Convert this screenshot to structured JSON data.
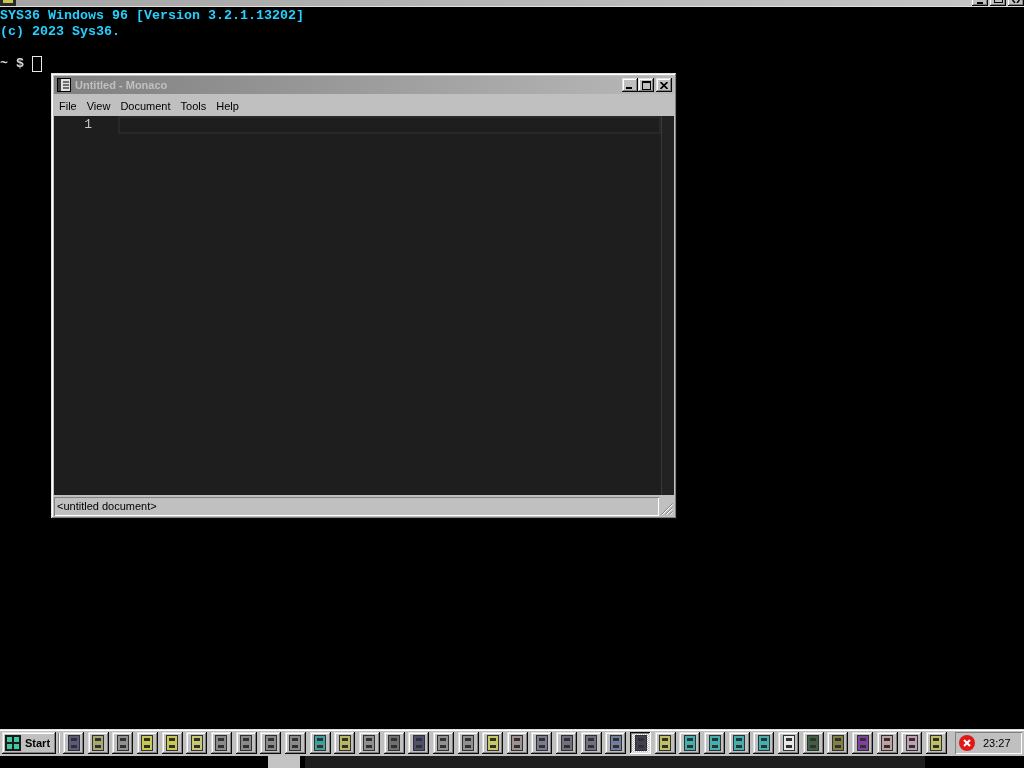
{
  "terminal": {
    "lines": [
      "SYS36 Windows 96 [Version 3.2.1.13202]",
      "(c) 2023 Sys36."
    ],
    "prompt": "~ $"
  },
  "window": {
    "title": "Untitled - Monaco",
    "active": false,
    "menu": [
      "File",
      "View",
      "Document",
      "Tools",
      "Help"
    ],
    "editor": {
      "line_numbers": [
        "1"
      ]
    },
    "status_bar": "<untitled document>"
  },
  "taskbar": {
    "start": "Start",
    "buttons": [
      {
        "selected": false,
        "color": "#5a5a7a"
      },
      {
        "selected": false,
        "color": "#a8a870"
      },
      {
        "selected": false,
        "color": "#909090"
      },
      {
        "selected": false,
        "color": "#c8c850"
      },
      {
        "selected": false,
        "color": "#c8c850"
      },
      {
        "selected": false,
        "color": "#c8c870"
      },
      {
        "selected": false,
        "color": "#8a8a8a"
      },
      {
        "selected": false,
        "color": "#8a8a8a"
      },
      {
        "selected": false,
        "color": "#8a8a8a"
      },
      {
        "selected": false,
        "color": "#8a8a8a"
      },
      {
        "selected": false,
        "color": "#40a0a0"
      },
      {
        "selected": false,
        "color": "#b8b860"
      },
      {
        "selected": false,
        "color": "#909090"
      },
      {
        "selected": false,
        "color": "#707070"
      },
      {
        "selected": false,
        "color": "#505070"
      },
      {
        "selected": false,
        "color": "#909090"
      },
      {
        "selected": false,
        "color": "#909090"
      },
      {
        "selected": false,
        "color": "#c8c860"
      },
      {
        "selected": false,
        "color": "#a09090"
      },
      {
        "selected": false,
        "color": "#7a7a90"
      },
      {
        "selected": false,
        "color": "#707080"
      },
      {
        "selected": false,
        "color": "#707080"
      },
      {
        "selected": false,
        "color": "#7080a0"
      },
      {
        "selected": true,
        "color": "#404050"
      },
      {
        "selected": false,
        "color": "#c0c060"
      },
      {
        "selected": false,
        "color": "#40b0b0"
      },
      {
        "selected": false,
        "color": "#40b0b0"
      },
      {
        "selected": false,
        "color": "#40b0b0"
      },
      {
        "selected": false,
        "color": "#40b0b0"
      },
      {
        "selected": false,
        "color": "#e8e8e8"
      },
      {
        "selected": false,
        "color": "#406040"
      },
      {
        "selected": false,
        "color": "#808040"
      },
      {
        "selected": false,
        "color": "#8040a0"
      },
      {
        "selected": false,
        "color": "#c0a0a0"
      },
      {
        "selected": false,
        "color": "#c0a0b0"
      },
      {
        "selected": false,
        "color": "#c0c060"
      }
    ],
    "clock": "23:27"
  }
}
